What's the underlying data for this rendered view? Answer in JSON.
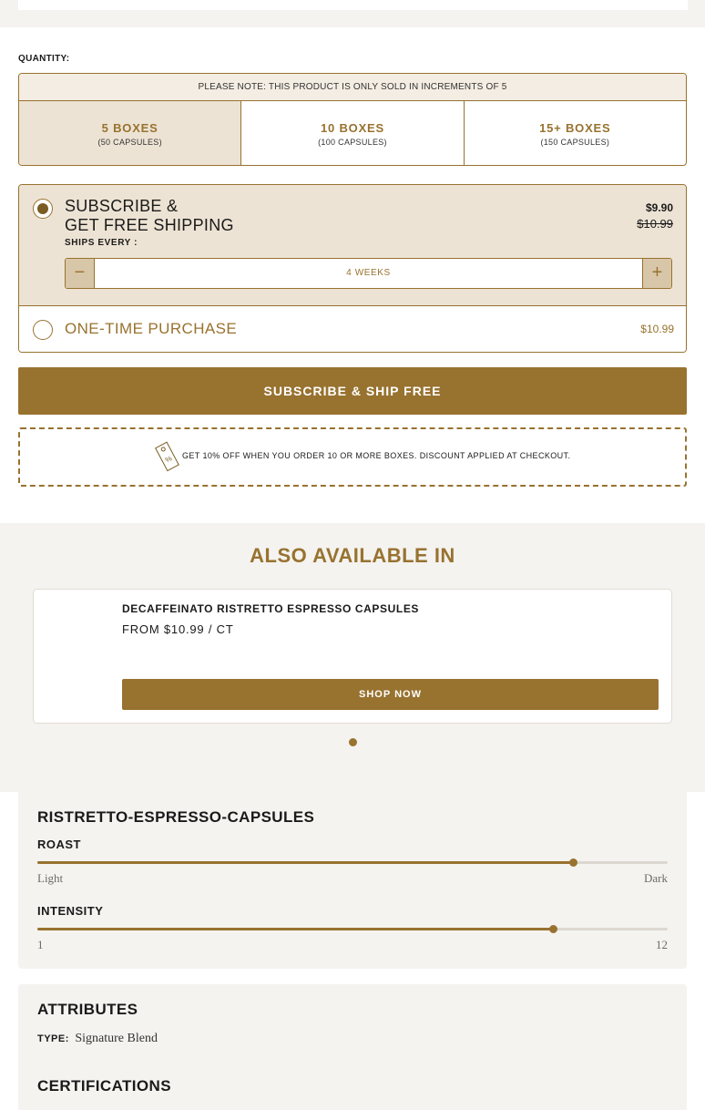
{
  "quantity": {
    "label": "QUANTITY:",
    "note": "PLEASE NOTE: THIS PRODUCT IS ONLY SOLD IN INCREMENTS OF 5",
    "options": [
      {
        "title": "5 BOXES",
        "sub": "(50 CAPSULES)",
        "selected": true
      },
      {
        "title": "10 BOXES",
        "sub": "(100 CAPSULES)",
        "selected": false
      },
      {
        "title": "15+ BOXES",
        "sub": "(150 CAPSULES)",
        "selected": false
      }
    ]
  },
  "purchase": {
    "subscribe": {
      "title_line1": "SUBSCRIBE &",
      "title_line2": "GET FREE SHIPPING",
      "price": "$9.90",
      "original_price": "$10.99",
      "ships_every_label": "SHIPS EVERY :",
      "frequency": "4 WEEKS",
      "minus_symbol": "−",
      "plus_symbol": "+",
      "selected": true
    },
    "one_time": {
      "title": "ONE-TIME PURCHASE",
      "price": "$10.99",
      "selected": false
    }
  },
  "cta": {
    "label": "SUBSCRIBE & SHIP FREE"
  },
  "promo": {
    "icon": "discount-tag-icon",
    "text": "GET 10% OFF WHEN YOU ORDER 10 OR MORE BOXES. DISCOUNT APPLIED AT CHECKOUT."
  },
  "also_available": {
    "title": "ALSO AVAILABLE IN",
    "products": [
      {
        "name": "DECAFFEINATO RISTRETTO ESPRESSO CAPSULES",
        "price": "FROM $10.99 / CT",
        "button": "SHOP NOW"
      }
    ],
    "carousel_dots": 1
  },
  "profile": {
    "title": "RISTRETTO-ESPRESSO-CAPSULES",
    "roast": {
      "label": "ROAST",
      "min_label": "Light",
      "max_label": "Dark",
      "level": 0.85
    },
    "intensity": {
      "label": "INTENSITY",
      "min_label": "1",
      "max_label": "12",
      "value": 10
    }
  },
  "attributes": {
    "title": "ATTRIBUTES",
    "type_label": "TYPE:",
    "type_value": "Signature Blend",
    "certifications_title": "CERTIFICATIONS"
  },
  "colors": {
    "accent": "#98722f",
    "selected_bg": "#ede3d4",
    "panel_bg": "#f4f3f0"
  }
}
